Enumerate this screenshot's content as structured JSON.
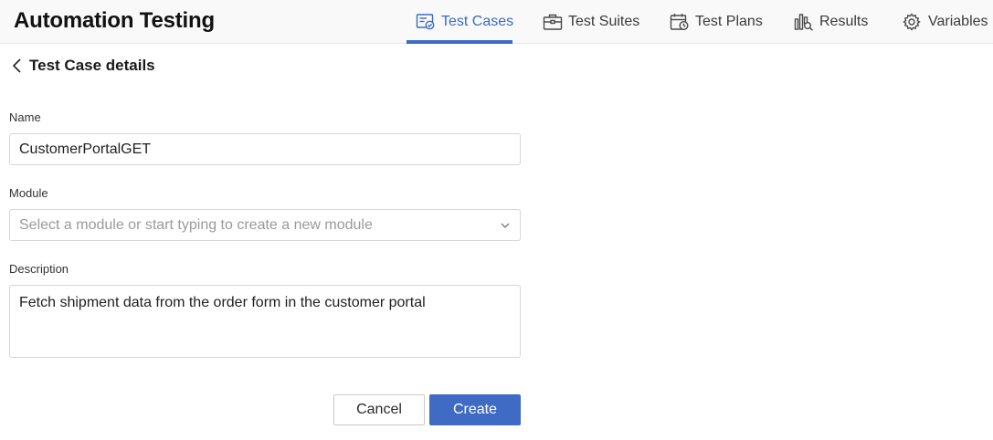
{
  "app": {
    "title": "Automation Testing"
  },
  "nav": {
    "items": [
      {
        "label": "Test Cases",
        "icon": "test-cases-icon",
        "active": true
      },
      {
        "label": "Test Suites",
        "icon": "briefcase-icon",
        "active": false
      },
      {
        "label": "Test Plans",
        "icon": "calendar-clock-icon",
        "active": false
      },
      {
        "label": "Results",
        "icon": "chart-search-icon",
        "active": false
      },
      {
        "label": "Variables",
        "icon": "gear-icon",
        "active": false
      }
    ]
  },
  "page": {
    "title": "Test Case details"
  },
  "form": {
    "name": {
      "label": "Name",
      "value": "CustomerPortalGET"
    },
    "module": {
      "label": "Module",
      "placeholder": "Select a module or start typing to create a new module"
    },
    "description": {
      "label": "Description",
      "value": "Fetch shipment data from the order form in the customer portal"
    }
  },
  "actions": {
    "cancel_label": "Cancel",
    "create_label": "Create"
  },
  "colors": {
    "accent": "#3a6ac7",
    "primary_button": "#3f6bc5",
    "topbar_bg": "#f9f9fa"
  }
}
